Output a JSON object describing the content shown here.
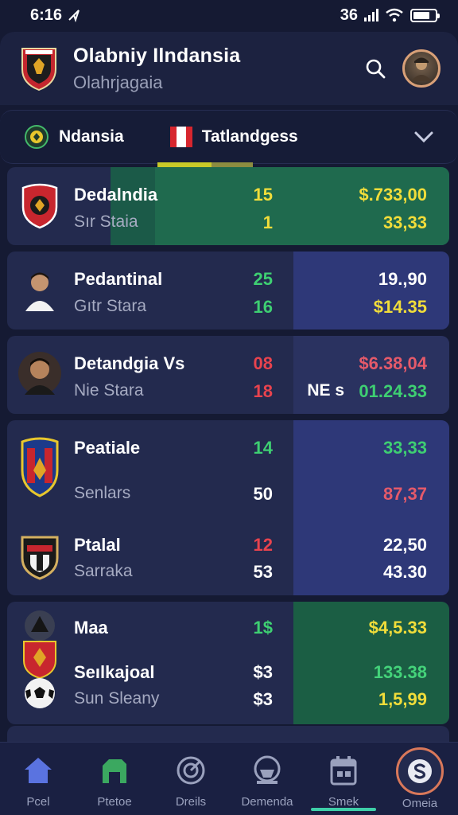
{
  "status": {
    "time": "6:16",
    "net": "36"
  },
  "header": {
    "title": "Olabniy Ilndansia",
    "subtitle": "Olahrjagaia"
  },
  "filters": {
    "left": "Ndansia",
    "right": "Tatlandgess"
  },
  "rows": [
    {
      "name": "Dedalndia",
      "sub": "Sır Staia",
      "num1": "15",
      "num2": "1",
      "val1": "$.733,00",
      "val2": "33,33"
    },
    {
      "name": "Pedantinal",
      "sub": "Gıtr Stara",
      "num1": "25",
      "num2": "16",
      "val1": "19.,90",
      "val2": "$14.35"
    },
    {
      "name": "Detandgia Vs",
      "sub": "Nie Stara",
      "num1": "08",
      "num2": "18",
      "ne": "NE s",
      "val1": "$6.38,04",
      "val2": "01.24.33"
    },
    {
      "name": "Peatiale",
      "sub": "Senlars",
      "num1": "14",
      "num2": "50",
      "val1": "33,33",
      "val2": "87,37"
    },
    {
      "name": "Ptalal",
      "sub": "Sarraka",
      "num1": "12",
      "num2": "53",
      "val1": "22,50",
      "val2": "43.30"
    },
    {
      "name": "Maa",
      "sub": "Seılkajoal",
      "sub2": "Sun Sleany",
      "num1": "1$",
      "num2": "$3",
      "num3": "$3",
      "val1": "$4,5.33",
      "val2": "133.38",
      "val3": "1,5,99"
    }
  ],
  "nav": [
    {
      "label": "Pcel",
      "icon": "home-icon"
    },
    {
      "label": "Ptetoe",
      "icon": "stadium-icon"
    },
    {
      "label": "Dreils",
      "icon": "target-icon"
    },
    {
      "label": "Demenda",
      "icon": "ball-icon"
    },
    {
      "label": "Smek",
      "icon": "calendar-icon"
    },
    {
      "label": "Omeia",
      "icon": "dollar-icon"
    }
  ],
  "colors": {
    "background": "#151a33",
    "card": "#232a4e",
    "highlight_green": "#1c5e4a",
    "highlight_blue": "#2e3878",
    "positive": "#3ecf72",
    "negative": "#e8434e",
    "accent_yellow": "#f1dd3a"
  }
}
